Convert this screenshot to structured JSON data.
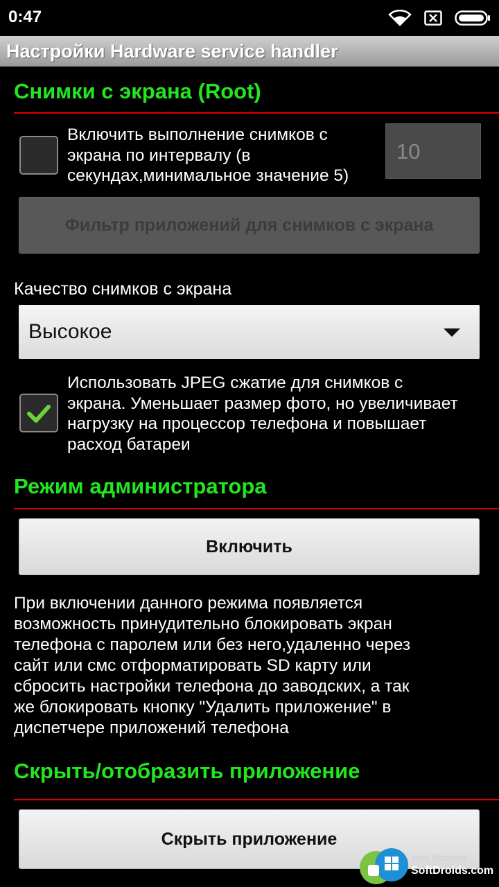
{
  "status_bar": {
    "time": "0:47",
    "icons": [
      "wifi-icon",
      "sim-missing-icon",
      "battery-icon"
    ]
  },
  "title_bar": {
    "title": "Настройки Hardware service handler"
  },
  "screenshots_section": {
    "title": "Снимки с экрана (Root)",
    "interval_checkbox": {
      "checked": false,
      "label_lines": [
        "Включить выполнение снимков с",
        "экрана по интервалу (в",
        "секундах,минимальное значение 5)"
      ]
    },
    "interval_field": {
      "value": "10"
    },
    "filter_button": "Фильтр приложений для снимков с экрана",
    "quality_label": "Качество снимков с экрана",
    "quality_spinner": {
      "selected": "Высокое"
    },
    "jpeg_checkbox": {
      "checked": true,
      "label_lines": [
        "Использовать JPEG сжатие для снимков с",
        "экрана. Уменьшает размер фото, но увеличивает",
        "нагрузку на процессор телефона и повышает",
        "расход батареи"
      ]
    }
  },
  "admin_section": {
    "title": "Режим администратора",
    "enable_button": "Включить",
    "description_lines": [
      "При включении данного режима появляется",
      "возможность принудительно блокировать экран",
      "телефона с паролем или без него,удаленно через",
      "сайт или смс отформатировать SD карту или",
      "сбросить настройки телефона до заводских, а так",
      "же блокировать кнопку \"Удалить приложение\" в",
      "диспетчере приложений телефона"
    ]
  },
  "hide_section": {
    "title": "Скрыть/отобразить приложение",
    "hide_button": "Скрыть приложение"
  },
  "watermark": {
    "line1": "Your Software",
    "line2": "SoftDroids.com"
  },
  "colors": {
    "section_title": "#22e61f",
    "divider": "#e00000",
    "checkmark": "#6fd23a"
  }
}
